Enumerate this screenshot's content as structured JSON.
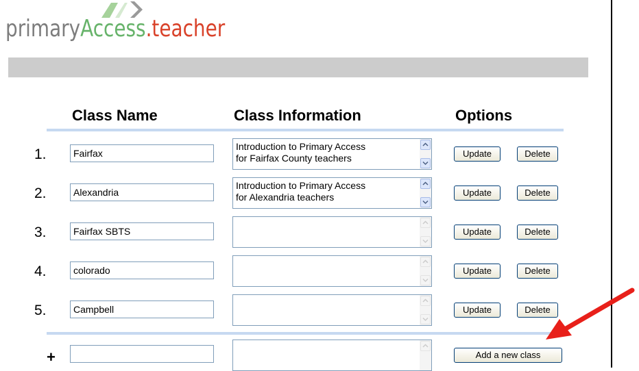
{
  "logo": {
    "part1": "primary",
    "part2": "Access",
    "part3": ".teacher"
  },
  "headers": {
    "class_name": "Class Name",
    "class_information": "Class Information",
    "options": "Options"
  },
  "rows": [
    {
      "number": "1.",
      "name": "Fairfax",
      "info": "Introduction to Primary Access\nfor Fairfax County teachers",
      "scroll_enabled": true
    },
    {
      "number": "2.",
      "name": "Alexandria",
      "info": "Introduction to Primary Access\nfor Alexandria teachers",
      "scroll_enabled": true
    },
    {
      "number": "3.",
      "name": "Fairfax SBTS",
      "info": "",
      "scroll_enabled": false
    },
    {
      "number": "4.",
      "name": "colorado",
      "info": "",
      "scroll_enabled": false
    },
    {
      "number": "5.",
      "name": "Campbell",
      "info": "",
      "scroll_enabled": false
    }
  ],
  "buttons": {
    "update": "Update",
    "delete": "Delete",
    "add": "Add a new class"
  },
  "new_row": {
    "symbol": "+",
    "name": "",
    "info": ""
  },
  "colors": {
    "separator": "#c6d9f1",
    "arrow": "#e8201a",
    "header_bar": "#cccccc"
  }
}
